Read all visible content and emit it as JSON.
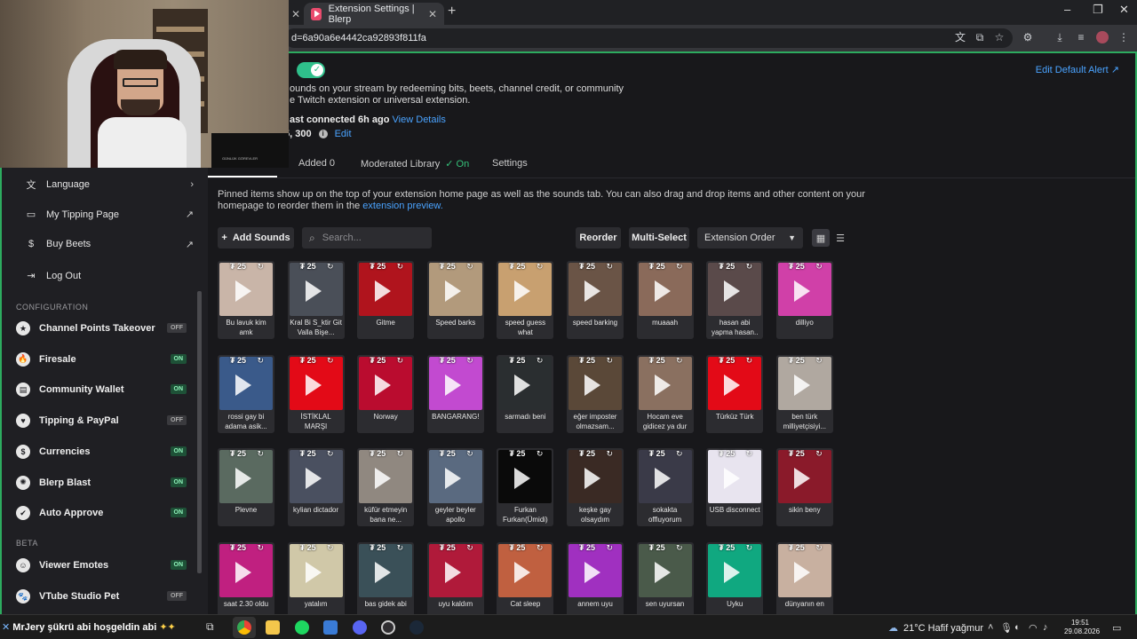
{
  "browser": {
    "tab_title": "Extension Settings | Blerp",
    "url_fragment": "d=6a90a6e4442ca92893f811fa"
  },
  "header": {
    "desc_line1": "ounds on your stream by redeeming bits, beets, channel credit, or community",
    "desc_line2": "e Twitch extension or universal extension.",
    "connected_text": "ast connected 6h ago",
    "view_details": "View Details",
    "price_text": "5, 300",
    "edit_label": "Edit",
    "edit_default_alert": "Edit Default Alert ↗"
  },
  "tabs": {
    "added": "Added  0",
    "moderated": "Moderated Library",
    "moderated_status": "✓ On",
    "settings": "Settings"
  },
  "pinned_note": "Pinned items show up on the top of your extension home page as well as the sounds tab. You can also drag and drop items and other content on your homepage to reorder them in the",
  "pinned_link": "extension preview.",
  "toolbar": {
    "add_sounds": "Add Sounds",
    "search_placeholder": "Search...",
    "reorder": "Reorder",
    "multi_select": "Multi-Select",
    "sort_value": "Extension Order"
  },
  "sounds": [
    {
      "label": "Bu lavuk kim amk",
      "price": "25",
      "color": "#c9b5a8"
    },
    {
      "label": "Kral Bi S_ktir Git Valla Bişe...",
      "price": "25",
      "color": "#4a4f58"
    },
    {
      "label": "Gitme",
      "price": "25",
      "color": "#b0141d"
    },
    {
      "label": "Speed barks",
      "price": "25",
      "color": "#b29a7c"
    },
    {
      "label": "speed guess what",
      "price": "25",
      "color": "#c8a070"
    },
    {
      "label": "speed barking",
      "price": "25",
      "color": "#6a5446"
    },
    {
      "label": "muaaah",
      "price": "25",
      "color": "#8a6a5a"
    },
    {
      "label": "hasan abi yapma hasan..",
      "price": "25",
      "color": "#5a4a4a"
    },
    {
      "label": "dilliyo",
      "price": "25",
      "color": "#d040a8"
    },
    {
      "label": "rossi gay bi adama asik...",
      "price": "25",
      "color": "#3a5a8a"
    },
    {
      "label": "İSTİKLAL MARŞI",
      "price": "25",
      "color": "#e30a17"
    },
    {
      "label": "Norway",
      "price": "25",
      "color": "#ba0c2f"
    },
    {
      "label": "BANGARANG!",
      "price": "25",
      "color": "#c24ad0"
    },
    {
      "label": "sarmadı beni",
      "price": "25",
      "color": "#2a2e30"
    },
    {
      "label": "eğer imposter olmazsam...",
      "price": "25",
      "color": "#5a4838"
    },
    {
      "label": "Hocam eve gidicez ya dur",
      "price": "25",
      "color": "#8a7060"
    },
    {
      "label": "Türküz Türk",
      "price": "25",
      "color": "#e30a17"
    },
    {
      "label": "ben türk milliyetçisiyi...",
      "price": "25",
      "color": "#b0a8a0"
    },
    {
      "label": "Plevne",
      "price": "25",
      "color": "#5a6a60"
    },
    {
      "label": "kylian dictador",
      "price": "25",
      "color": "#4a5060"
    },
    {
      "label": "küfür etmeyin bana ne...",
      "price": "25",
      "color": "#908880"
    },
    {
      "label": "geyler beyler apollo",
      "price": "25",
      "color": "#5a6a80"
    },
    {
      "label": "Furkan Furkan(Ümidi)",
      "price": "25",
      "color": "#0a0a0a"
    },
    {
      "label": "keşke gay olsaydım",
      "price": "25",
      "color": "#3a2a24"
    },
    {
      "label": "sokakta offluyorum",
      "price": "25",
      "color": "#3a3a48"
    },
    {
      "label": "USB disconnect",
      "price": "25",
      "color": "#e8e4ef"
    },
    {
      "label": "sikin beny",
      "price": "25",
      "color": "#8a1a2a"
    },
    {
      "label": "saat 2.30 oldu",
      "price": "25",
      "color": "#c02080"
    },
    {
      "label": "yatalım",
      "price": "25",
      "color": "#d0c8a8"
    },
    {
      "label": "bas gidek abi",
      "price": "25",
      "color": "#3a5058"
    },
    {
      "label": "uyu kaldım",
      "price": "25",
      "color": "#b01a3a"
    },
    {
      "label": "Cat sleep",
      "price": "25",
      "color": "#c06040"
    },
    {
      "label": "annem uyu",
      "price": "25",
      "color": "#a030c0"
    },
    {
      "label": "sen uyursan",
      "price": "25",
      "color": "#4a5a4a"
    },
    {
      "label": "Uyku",
      "price": "25",
      "color": "#10a880"
    },
    {
      "label": "dünyanın en",
      "price": "25",
      "color": "#c8b0a0"
    }
  ],
  "menu": {
    "language": "Language",
    "tipping_page": "My Tipping Page",
    "buy_beets": "Buy Beets",
    "logout": "Log Out"
  },
  "sidebar": {
    "config_head": "CONFIGURATION",
    "beta_head": "BETA",
    "items": [
      {
        "label": "Channel Points Takeover",
        "status": "OFF"
      },
      {
        "label": "Firesale",
        "status": "ON"
      },
      {
        "label": "Community Wallet",
        "status": "ON"
      },
      {
        "label": "Tipping & PayPal",
        "status": "OFF"
      },
      {
        "label": "Currencies",
        "status": "ON"
      },
      {
        "label": "Blerp Blast",
        "status": "ON"
      },
      {
        "label": "Auto Approve",
        "status": "ON"
      }
    ],
    "beta_items": [
      {
        "label": "Viewer Emotes",
        "status": "ON"
      },
      {
        "label": "VTube Studio Pet",
        "status": "OFF"
      }
    ]
  },
  "webcam": {
    "screen_text": "GÜNLÜK GÖREVLER"
  },
  "taskbar": {
    "ticker_name": "MrJery",
    "ticker_msg": "şükrü abi hoşgeldin abi",
    "weather": "21°C  Hafif yağmur",
    "time": "19:51",
    "date": "29.08.2026"
  }
}
